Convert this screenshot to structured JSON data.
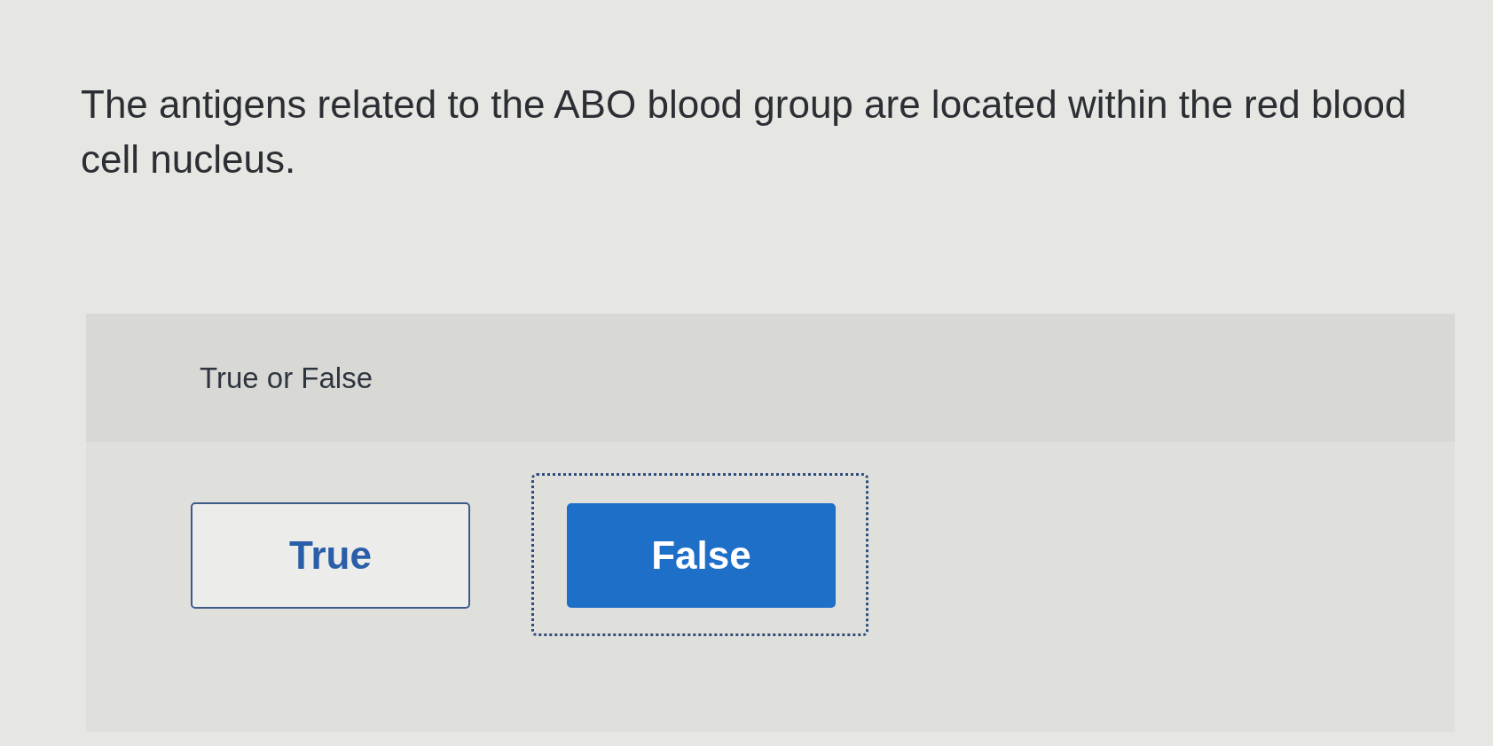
{
  "question": {
    "text": "The antigens related to the ABO blood group are located within the red blood cell nucleus."
  },
  "answer_panel": {
    "prompt": "True or False",
    "options": [
      {
        "label": "True",
        "selected": false,
        "focused": false
      },
      {
        "label": "False",
        "selected": true,
        "focused": true
      }
    ]
  }
}
